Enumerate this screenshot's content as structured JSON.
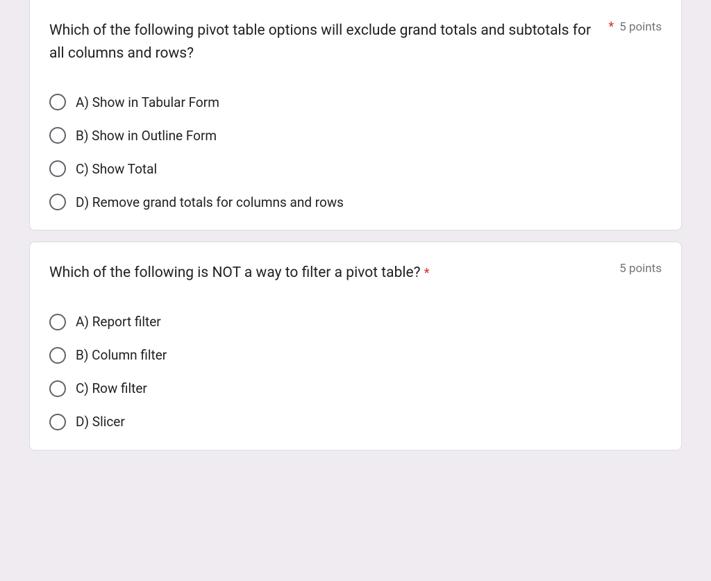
{
  "questions": [
    {
      "text": "Which of the following pivot table options will exclude grand totals and subtotals for all columns and rows?",
      "requiredInText": false,
      "points": "5 points",
      "requiredInPoints": true,
      "options": [
        "A) Show in Tabular Form",
        "B) Show in Outline Form",
        "C) Show Total",
        "D) Remove grand totals for columns and rows"
      ]
    },
    {
      "text": "Which of the following is NOT a way to filter a pivot table? ",
      "requiredInText": true,
      "points": "5 points",
      "requiredInPoints": false,
      "options": [
        "A) Report filter",
        "B) Column filter",
        "C) Row filter",
        "D) Slicer"
      ]
    }
  ],
  "asterisk": "*"
}
